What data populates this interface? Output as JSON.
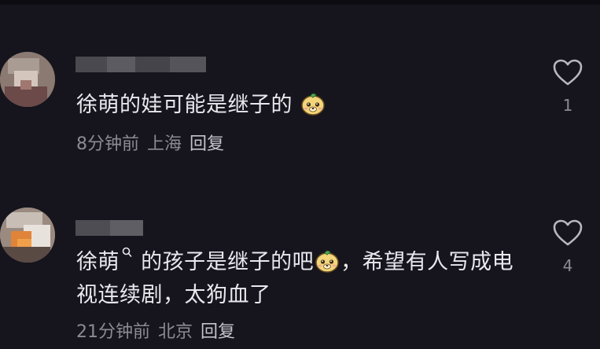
{
  "comments": [
    {
      "text": "徐萌的娃可能是继子的",
      "emoji": "douyin-emoji-face",
      "time": "8分钟前",
      "location": "上海",
      "reply_label": "回复",
      "like_count": "1"
    },
    {
      "text_part1": "徐萌",
      "mention_icon": "search-link-icon",
      "text_part2": " 的孩子是继子的吧",
      "emoji": "douyin-emoji-face",
      "text_part3": "，希望有人写成电视连续剧，太狗血了",
      "time": "21分钟前",
      "location": "北京",
      "reply_label": "回复",
      "like_count": "4"
    }
  ],
  "colors": {
    "background": "#16151d",
    "text": "#e9e8ee",
    "meta_text": "#8c8b93",
    "icon": "#b8b7be"
  }
}
